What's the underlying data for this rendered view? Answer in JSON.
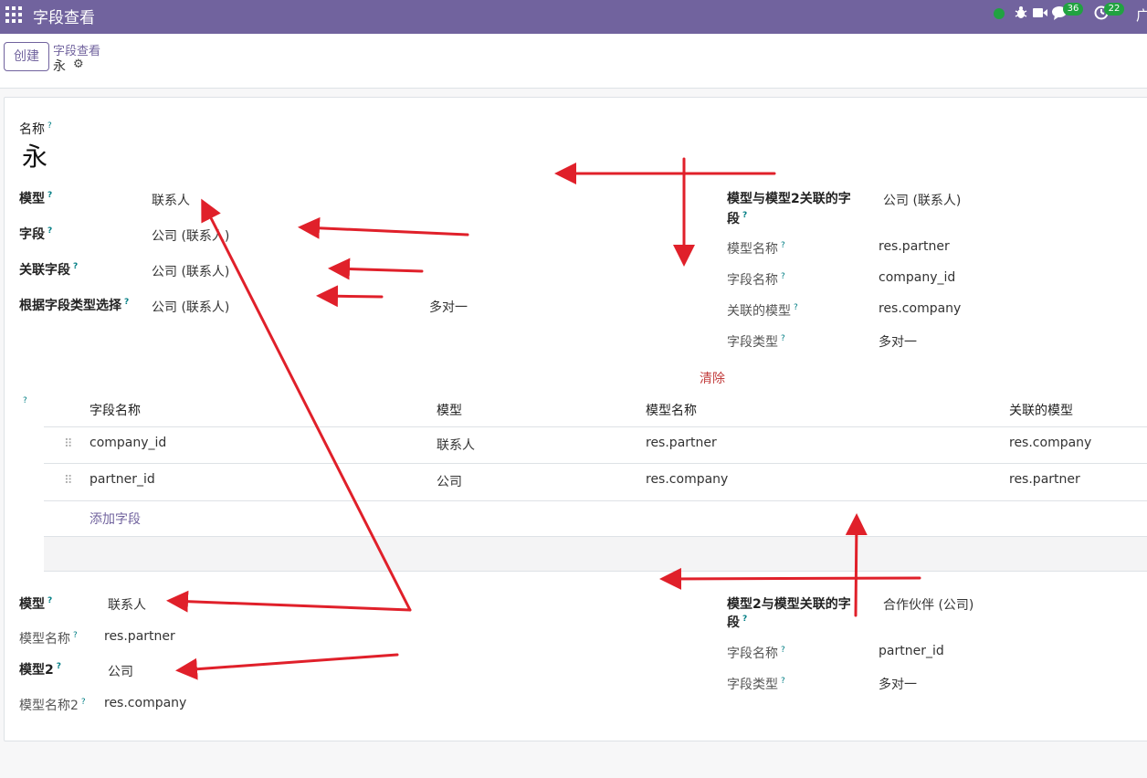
{
  "topbar": {
    "title": "字段查看",
    "messages_count": "36",
    "activities_count": "22",
    "right_text": "广"
  },
  "control": {
    "create_label": "创建",
    "breadcrumb_parent": "字段查看",
    "breadcrumb_current": "永"
  },
  "form": {
    "name_label": "名称",
    "name_value": "永",
    "q": "?",
    "left": [
      {
        "label": "模型",
        "value": "联系人"
      },
      {
        "label": "字段",
        "value": "公司 (联系人)"
      },
      {
        "label": "关联字段",
        "value": "公司 (联系人)"
      },
      {
        "label": "根据字段类型选择",
        "value": "公司 (联系人)",
        "extra": "多对一"
      }
    ],
    "right_top": {
      "main_label_line1": "模型与模型2关联的字",
      "main_label_line2": "段",
      "main_value": "公司 (联系人)",
      "rows": [
        {
          "label": "模型名称",
          "value": "res.partner"
        },
        {
          "label": "字段名称",
          "value": "company_id"
        },
        {
          "label": "关联的模型",
          "value": "res.company"
        },
        {
          "label": "字段类型",
          "value": "多对一"
        }
      ]
    },
    "clear_label": "清除",
    "table": {
      "columns": [
        "字段名称",
        "模型",
        "模型名称",
        "关联的模型"
      ],
      "rows": [
        [
          "company_id",
          "联系人",
          "res.partner",
          "res.company"
        ],
        [
          "partner_id",
          "公司",
          "res.company",
          "res.partner"
        ]
      ],
      "add_label": "添加字段"
    },
    "bottom_left": [
      {
        "label": "模型",
        "value": "联系人"
      },
      {
        "label": "模型名称",
        "value": "res.partner"
      },
      {
        "label": "模型2",
        "value": "公司"
      },
      {
        "label": "模型名称2",
        "value": "res.company"
      }
    ],
    "bottom_right": {
      "main_label_line1": "模型2与模型关联的字",
      "main_label_line2": "段",
      "main_value": "合作伙伴 (公司)",
      "rows": [
        {
          "label": "字段名称",
          "value": "partner_id"
        },
        {
          "label": "字段类型",
          "value": "多对一"
        }
      ]
    }
  },
  "colors": {
    "brand": "#71639e",
    "arrow": "#e0202a",
    "status_green": "#21a241"
  }
}
